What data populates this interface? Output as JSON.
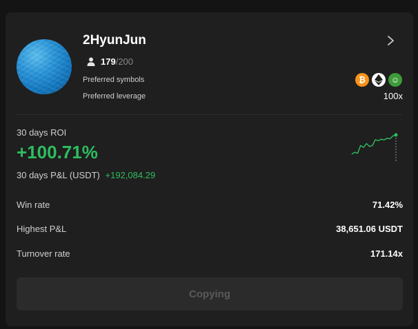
{
  "trader": {
    "name": "2HyunJun",
    "followers_current": "179",
    "followers_max": "/200",
    "preferred_symbols_label": "Preferred symbols",
    "preferred_leverage_label": "Preferred leverage",
    "leverage": "100x",
    "symbols": [
      {
        "icon": "bitcoin-icon",
        "glyph": "₿",
        "color": "#f7931a"
      },
      {
        "icon": "ethereum-icon",
        "glyph": "◆",
        "color": "#ffffff"
      },
      {
        "icon": "pepe-icon",
        "glyph": "☺",
        "color": "#3e9b3a"
      }
    ]
  },
  "performance": {
    "roi_label": "30 days ROI",
    "roi_value": "+100.71%",
    "pnl_label": "30 days P&L (USDT)",
    "pnl_value": "+192,084.29",
    "roi_color": "#2ebd5f",
    "sparkline": [
      0.0,
      0.1,
      0.05,
      0.45,
      0.35,
      0.55,
      0.4,
      0.45,
      0.75,
      0.7,
      0.78,
      0.74,
      0.82,
      0.8,
      0.95,
      1.0
    ]
  },
  "stats": [
    {
      "label": "Win rate",
      "value": "71.42%"
    },
    {
      "label": "Highest P&L",
      "value": "38,651.06 USDT"
    },
    {
      "label": "Turnover rate",
      "value": "171.14x"
    }
  ],
  "action": {
    "button_label": "Copying",
    "disabled": true
  }
}
